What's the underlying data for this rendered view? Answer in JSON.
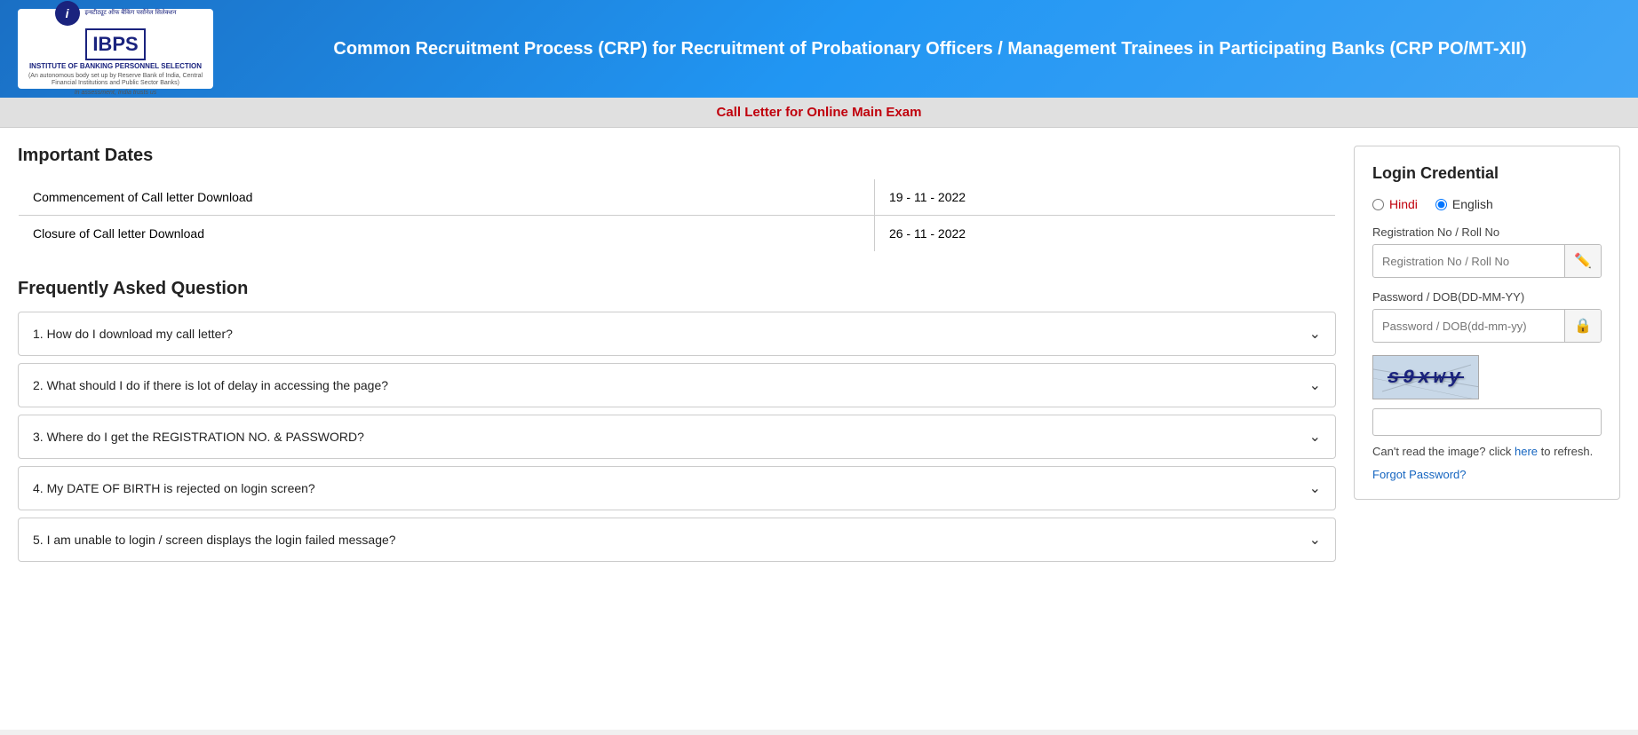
{
  "header": {
    "title": "Common Recruitment Process (CRP) for Recruitment of Probationary Officers / Management Trainees in Participating Banks (CRP PO/MT-XII)",
    "logo": {
      "ibps_label": "IBPS",
      "org_name_hindi": "इन्स्टीट्यूट ऑफ बैंकिंग पर्सोनेल सिलेक्शन",
      "org_name_english": "INSTITUTE OF BANKING PERSONNEL SELECTION",
      "tagline1": "(An autonomous body set up by Reserve Bank of India, Central Financial Institutions and Public Sector Banks)",
      "tagline2": "In assessment, India trusts us"
    }
  },
  "sub_banner": {
    "text": "Call Letter for Online Main Exam"
  },
  "important_dates": {
    "section_title": "Important Dates",
    "rows": [
      {
        "label": "Commencement of Call letter Download",
        "date": "19 - 11 - 2022"
      },
      {
        "label": "Closure of Call letter Download",
        "date": "26 - 11 - 2022"
      }
    ]
  },
  "faq": {
    "section_title": "Frequently Asked Question",
    "items": [
      {
        "id": 1,
        "question": "1. How do I download my call letter?"
      },
      {
        "id": 2,
        "question": "2. What should I do if there is lot of delay in accessing the page?"
      },
      {
        "id": 3,
        "question": "3. Where do I get the REGISTRATION NO. & PASSWORD?"
      },
      {
        "id": 4,
        "question": "4. My DATE OF BIRTH is rejected on login screen?"
      },
      {
        "id": 5,
        "question": "5. I am unable to login / screen displays the login failed message?"
      }
    ]
  },
  "login": {
    "title": "Login Credential",
    "language_options": {
      "hindi_label": "Hindi",
      "english_label": "English",
      "selected": "english"
    },
    "reg_no_label": "Registration No / Roll No",
    "reg_no_placeholder": "Registration No / Roll No",
    "password_label": "Password / DOB(DD-MM-YY)",
    "password_placeholder": "Password / DOB(dd-mm-yy)",
    "captcha_text": "s9xwy",
    "captcha_hint_prefix": "Can't read the image? click ",
    "captcha_hint_link": "here",
    "captcha_hint_suffix": " to refresh.",
    "forgot_password": "Forgot Password?"
  }
}
